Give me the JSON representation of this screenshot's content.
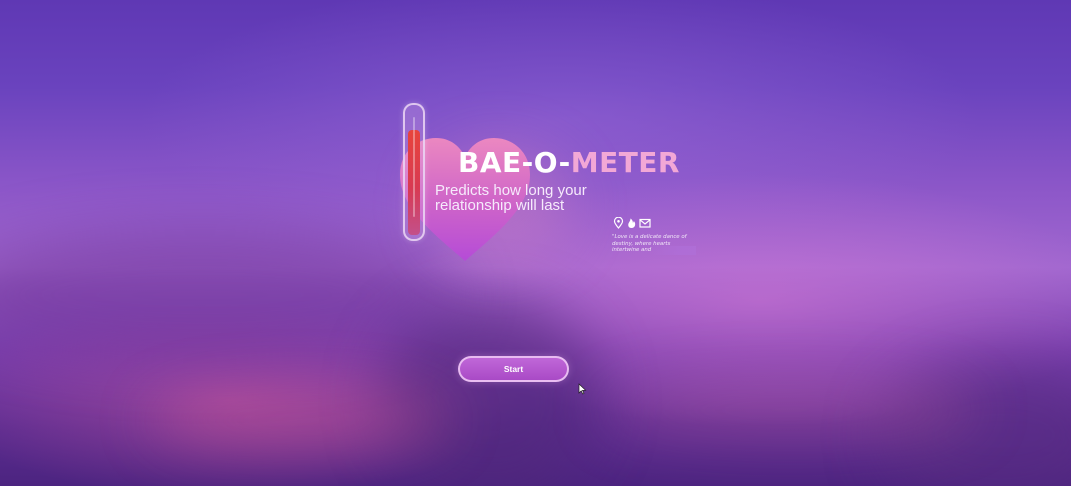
{
  "app": {
    "title_part1": "BAE-O-",
    "title_part2": "METER",
    "subtitle": "Predicts how long your relationship will last"
  },
  "meter": {
    "level": 0.86,
    "fill_color": "#e8443c"
  },
  "icons": [
    "location-pin-icon",
    "flame-icon",
    "envelope-icon"
  ],
  "quote": {
    "text": "\"Love is a delicate dance of destiny, where hearts intertwine and"
  },
  "start_button": {
    "label": "Start"
  },
  "colors": {
    "background_top": "#5f38b4",
    "background_mid": "#a067cf",
    "heart_top": "#f08ac0",
    "heart_bottom": "#b64ad8",
    "title_accent": "#f2a8d6",
    "button": "#b456cf"
  }
}
